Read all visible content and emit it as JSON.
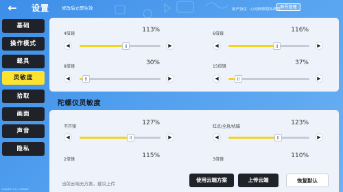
{
  "header": {
    "title": "设置",
    "notice": "修改后立即生效",
    "links": [
      "用户协议",
      "心动网络隐私政策"
    ],
    "account_button": "账号管理"
  },
  "sidebar": {
    "items": [
      {
        "label": "基础",
        "active": false
      },
      {
        "label": "操作模式",
        "active": false
      },
      {
        "label": "载具",
        "active": false
      },
      {
        "label": "灵敏度",
        "active": true
      },
      {
        "label": "拾取",
        "active": false
      },
      {
        "label": "画面",
        "active": false
      },
      {
        "label": "声音",
        "active": false
      },
      {
        "label": "隐私",
        "active": false
      }
    ],
    "version": "1.codefn 1.0.1 150202"
  },
  "scope_sliders": [
    {
      "label": "4倍镜",
      "value": "113%",
      "level": 0.57
    },
    {
      "label": "6倍镜",
      "value": "116%",
      "level": 0.59
    },
    {
      "label": "8倍镜",
      "value": "30%",
      "level": 0.08
    },
    {
      "label": "15倍镜",
      "value": "37%",
      "level": 0.12
    }
  ],
  "gyro_section": {
    "title": "陀螺仪灵敏度",
    "sliders": [
      {
        "label": "不开镜",
        "value": "127%",
        "level": 0.63
      },
      {
        "label": "红点/全息/机瞄",
        "value": "123%",
        "level": 0.61
      },
      {
        "label": "2倍镜",
        "value": "115%"
      },
      {
        "label": "3倍镜",
        "value": "110%"
      }
    ]
  },
  "footer": {
    "hint": "当前云端无方案，建议上传",
    "use_cloud": "使用云端方案",
    "upload_cloud": "上传云端",
    "restore_default": "恢复默认"
  },
  "icons": {
    "back": "back-arrow-icon",
    "left": "chevron-left-icon",
    "right": "chevron-right-icon"
  },
  "colors": {
    "accent_yellow": "#fde330",
    "dark": "#1f2228",
    "background_blue": "#4a9aee"
  }
}
